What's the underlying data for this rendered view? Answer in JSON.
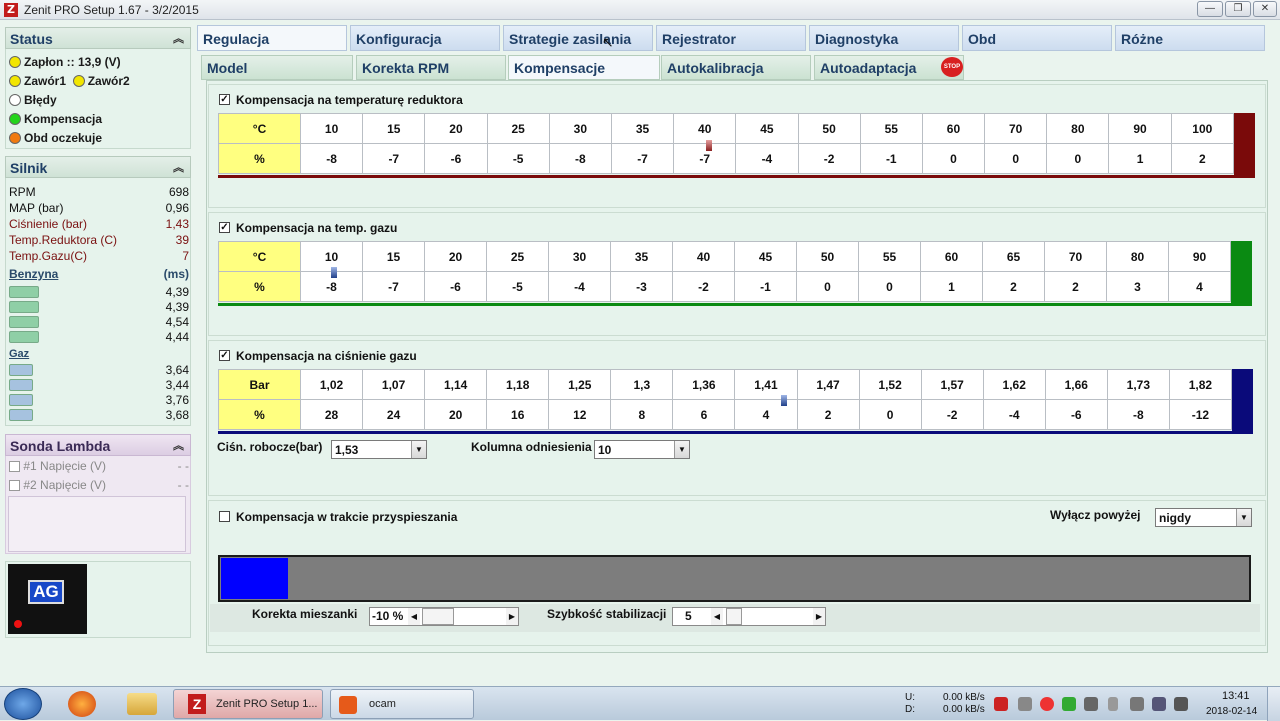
{
  "window": {
    "title": "Zenit PRO Setup 1.67 - 3/2/2015",
    "logo_letter": "Z"
  },
  "status": {
    "header": "Status",
    "rows": [
      {
        "label": "Zapłon :: 13,9 (V)",
        "color": "#f2e600"
      },
      {
        "label": "Zawór1",
        "color": "#f2e600",
        "label2": "Zawór2",
        "color2": "#f2e600"
      },
      {
        "label": "Błędy",
        "color": "#ffffff"
      },
      {
        "label": "Kompensacja",
        "color": "#22d41a"
      },
      {
        "label": "Obd oczekuje",
        "color": "#f07a10"
      }
    ]
  },
  "engine": {
    "header": "Silnik",
    "rows": [
      {
        "label": "RPM",
        "value": "698"
      },
      {
        "label": "MAP (bar)",
        "value": "0,96"
      },
      {
        "label": "Ciśnienie (bar)",
        "value": "1,43"
      },
      {
        "label": "Temp.Reduktora (C)",
        "value": "39"
      },
      {
        "label": "Temp.Gazu(C)",
        "value": "7"
      }
    ],
    "benzyna_label": "Benzyna",
    "unit_label": "(ms)",
    "benzyna": [
      "4,39",
      "4,39",
      "4,54",
      "4,44"
    ],
    "gaz_label": "Gaz",
    "gaz": [
      "3,64",
      "3,44",
      "3,76",
      "3,68"
    ]
  },
  "lambda": {
    "header": "Sonda Lambda",
    "rows": [
      {
        "label": "#1 Napięcie (V)",
        "value": "- -"
      },
      {
        "label": "#2 Napięcie (V)",
        "value": "- -"
      }
    ]
  },
  "logo_text": "AG",
  "tabs_top": [
    "Regulacja",
    "Konfiguracja",
    "Strategie zasilania",
    "Rejestrator",
    "Diagnostyka",
    "Obd",
    "Różne"
  ],
  "tabs_sub": [
    "Model",
    "Korekta RPM",
    "Kompensacje",
    "Autokalibracja",
    "Autoadaptacja"
  ],
  "stop_label": "STOP",
  "comp_temp_red": {
    "title": "Kompensacja na temperaturę reduktora",
    "row1_label": "°C",
    "row2_label": "%",
    "x": [
      "10",
      "15",
      "20",
      "25",
      "30",
      "35",
      "40",
      "45",
      "50",
      "55",
      "60",
      "70",
      "80",
      "90",
      "100"
    ],
    "y": [
      "-8",
      "-7",
      "-6",
      "-5",
      "-8",
      "-7",
      "-7",
      "-4",
      "-2",
      "-1",
      "0",
      "0",
      "0",
      "1",
      "2"
    ],
    "accent": "#7a0a0a"
  },
  "comp_temp_gaz": {
    "title": "Kompensacja na temp. gazu",
    "row1_label": "°C",
    "row2_label": "%",
    "x": [
      "10",
      "15",
      "20",
      "25",
      "30",
      "35",
      "40",
      "45",
      "50",
      "55",
      "60",
      "65",
      "70",
      "80",
      "90"
    ],
    "y": [
      "-8",
      "-7",
      "-6",
      "-5",
      "-4",
      "-3",
      "-2",
      "-1",
      "0",
      "0",
      "1",
      "2",
      "2",
      "3",
      "4"
    ],
    "accent": "#0a8a12"
  },
  "comp_cisn": {
    "title": "Kompensacja na ciśnienie gazu",
    "row1_label": "Bar",
    "row2_label": "%",
    "x": [
      "1,02",
      "1,07",
      "1,14",
      "1,18",
      "1,25",
      "1,3",
      "1,36",
      "1,41",
      "1,47",
      "1,52",
      "1,57",
      "1,62",
      "1,66",
      "1,73",
      "1,82"
    ],
    "y": [
      "28",
      "24",
      "20",
      "16",
      "12",
      "8",
      "6",
      "4",
      "2",
      "0",
      "-2",
      "-4",
      "-6",
      "-8",
      "-12"
    ],
    "accent": "#0a0a7a",
    "work_pressure_label": "Ciśn. robocze(bar)",
    "work_pressure_value": "1,53",
    "ref_column_label": "Kolumna odniesienia",
    "ref_column_value": "10"
  },
  "acceleration": {
    "title": "Kompensacja w trakcie przyspieszania",
    "disable_label": "Wyłącz powyżej",
    "disable_value": "nigdy",
    "mix_label": "Korekta mieszanki",
    "mix_value": "-10 %",
    "stab_label": "Szybkość stabilizacji",
    "stab_value": "5"
  },
  "taskbar": {
    "apps": [
      "Zenit PRO Setup 1...",
      "ocam"
    ],
    "net_u_label": "U:",
    "net_d_label": "D:",
    "net_u": "0.00 kB/s",
    "net_d": "0.00 kB/s",
    "time": "13:41",
    "date": "2018-02-14"
  }
}
